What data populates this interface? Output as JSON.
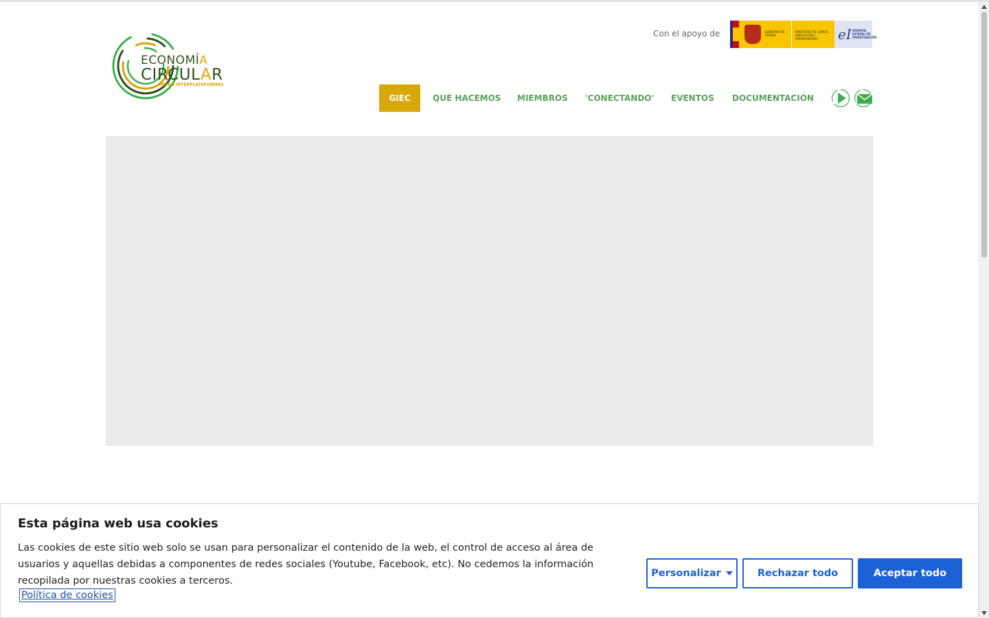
{
  "header": {
    "logo": {
      "line1_main": "ECONOMÍ",
      "line1_accent": "A",
      "line2_main": "CIRCUL",
      "line2_accent": "A",
      "line2_end": "R",
      "tagline": "GRUPO INTERPLATAFORMAS"
    },
    "support_text": "Con el apoyo de",
    "sponsor": {
      "gov_text": "GOBIERNO DE ESPAÑA",
      "ministry_text": "MINISTERIO DE CIENCIA, INNOVACIÓN Y UNIVERSIDADES",
      "agency_mark": "eI",
      "agency_text": "AGENCIA ESTATAL DE INVESTIGACIÓN"
    },
    "nav": [
      {
        "label": "GIEC",
        "active": true
      },
      {
        "label": "QUÉ HACEMOS",
        "active": false
      },
      {
        "label": "MIEMBROS",
        "active": false
      },
      {
        "label": "'CONECTANDO'",
        "active": false
      },
      {
        "label": "EVENTOS",
        "active": false
      },
      {
        "label": "DOCUMENTACIÓN",
        "active": false
      }
    ],
    "icons": [
      "play-icon",
      "mail-icon"
    ]
  },
  "colors": {
    "nav_green": "#5e9f5f",
    "active_gold": "#d8a709",
    "logo_dark_green": "#2f4f1c",
    "logo_green": "#3cae4e",
    "button_blue": "#1d61d6"
  },
  "cookie_banner": {
    "title": "Esta página web usa cookies",
    "text": "Las cookies de este sitio web solo se usan para personalizar el contenido de la web, el control de acceso al área de usuarios y aquellas debidas a componentes de redes sociales (Youtube, Facebook, etc). No cedemos la información recopilada por nuestras cookies a terceros.",
    "policy_link": "Política de cookies",
    "buttons": {
      "customize": "Personalizar",
      "reject": "Rechazar todo",
      "accept": "Aceptar todo"
    }
  }
}
